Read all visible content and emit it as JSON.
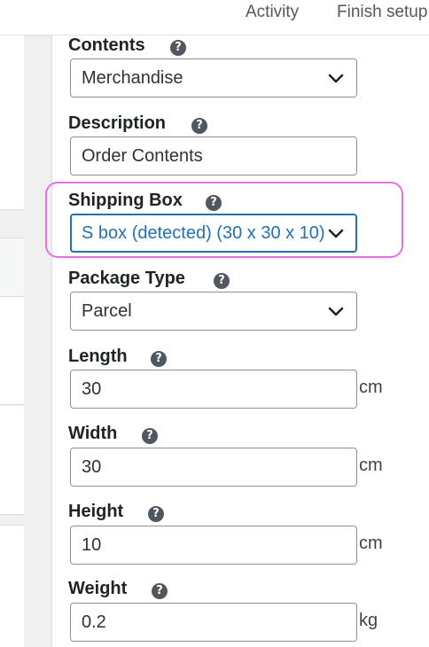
{
  "topbar": {
    "activity_label": "Activity",
    "finish_setup_label": "Finish setup"
  },
  "form": {
    "contents": {
      "label": "Contents",
      "value": "Merchandise"
    },
    "description": {
      "label": "Description",
      "value": "Order Contents"
    },
    "shipping_box": {
      "label": "Shipping Box",
      "value": "S box (detected) (30 x 30 x 10)"
    },
    "package_type": {
      "label": "Package Type",
      "value": "Parcel"
    },
    "length": {
      "label": "Length",
      "value": "30",
      "unit": "cm"
    },
    "width": {
      "label": "Width",
      "value": "30",
      "unit": "cm"
    },
    "height": {
      "label": "Height",
      "value": "10",
      "unit": "cm"
    },
    "weight": {
      "label": "Weight",
      "value": "0.2",
      "unit": "kg"
    }
  },
  "help_icon_glyph": "?",
  "colors": {
    "focus_blue": "#2271b1",
    "highlight_pink": "#e770e6",
    "help_icon_gray": "#50575e"
  }
}
